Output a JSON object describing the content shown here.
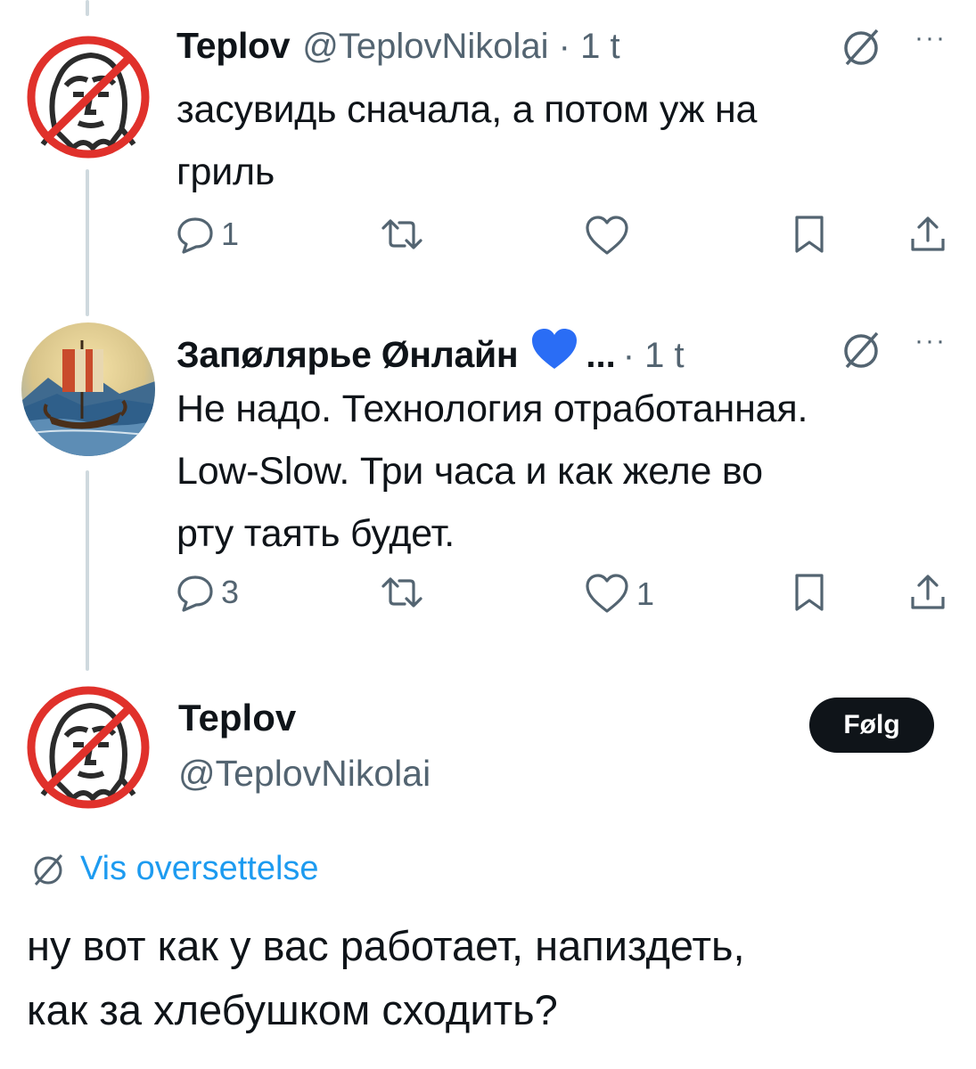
{
  "reply1": {
    "author_name": "Teplov",
    "handle_time": "@TeplovNikolai · 1 t",
    "text_line1": "засувидь сначала, а потом уж на",
    "text_line2": "гриль",
    "replies": "1",
    "reposts": "",
    "likes": "",
    "avatar_icon": "no-putin-icon"
  },
  "reply2": {
    "author_name": "Запøлярье Øнлайн",
    "badge_icon": "blue-heart-icon",
    "name_ellipsis": "...",
    "handle_time": "· 1 t",
    "text_line1": "Не надо. Технология отработанная.",
    "text_line2": "Low-Slow. Три часа и как желе во",
    "text_line3": "рту таять будет.",
    "replies": "3",
    "reposts": "",
    "likes": "1",
    "avatar_icon": "viking-ship-icon"
  },
  "main_tweet": {
    "author_name": "Teplov",
    "handle": "@TeplovNikolai",
    "follow_label": "Følg",
    "translate_label": "Vis oversettelse",
    "text_line1": "ну вот как у вас работает, напиздеть,",
    "text_line2": "как за хлебушком сходить?"
  },
  "colors": {
    "text": "#0f1419",
    "secondary": "#536471",
    "accent": "#1d9bf0",
    "thread_line": "#cfd9de",
    "prohibition_red": "#e0312b"
  }
}
